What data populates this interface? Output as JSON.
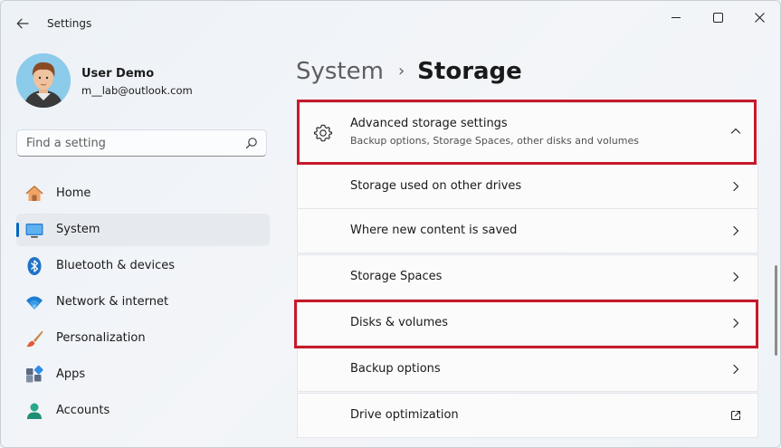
{
  "titlebar": {
    "title": "Settings",
    "back_icon": "back-arrow-icon"
  },
  "window_controls": [
    "minimize-icon",
    "maximize-icon",
    "close-icon"
  ],
  "user": {
    "name": "User Demo",
    "email": "m__lab@outlook.com"
  },
  "search": {
    "placeholder": "Find a setting",
    "value": ""
  },
  "nav": {
    "items": [
      {
        "label": "Home",
        "icon": "home-icon"
      },
      {
        "label": "System",
        "icon": "system-monitor-icon",
        "active": true
      },
      {
        "label": "Bluetooth & devices",
        "icon": "bluetooth-icon"
      },
      {
        "label": "Network & internet",
        "icon": "wifi-icon"
      },
      {
        "label": "Personalization",
        "icon": "paintbrush-icon"
      },
      {
        "label": "Apps",
        "icon": "apps-icon"
      },
      {
        "label": "Accounts",
        "icon": "person-icon"
      }
    ]
  },
  "breadcrumb": {
    "parent": "System",
    "separator": "›",
    "current": "Storage"
  },
  "advanced": {
    "title": "Advanced storage settings",
    "subtitle": "Backup options, Storage Spaces, other disks and volumes",
    "icon": "gear-icon",
    "expanded": true
  },
  "sub_items": [
    {
      "label": "Storage used on other drives",
      "icon": "chevron-right-icon"
    },
    {
      "label": "Where new content is saved",
      "icon": "chevron-right-icon"
    },
    {
      "label": "Storage Spaces",
      "icon": "chevron-right-icon"
    },
    {
      "label": "Disks & volumes",
      "icon": "chevron-right-icon"
    },
    {
      "label": "Backup options",
      "icon": "chevron-right-icon"
    },
    {
      "label": "Drive optimization",
      "icon": "external-link-icon"
    }
  ],
  "colors": {
    "accent": "#0067c0",
    "highlight": "#c7192a",
    "card": "#fbfbfc",
    "border": "#e3e6ea"
  }
}
